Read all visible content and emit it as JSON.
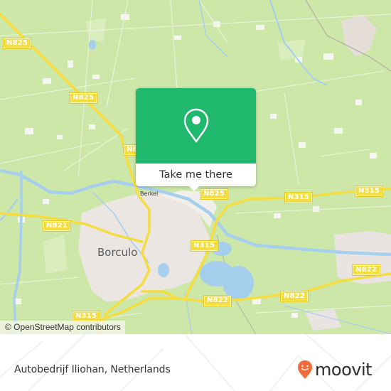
{
  "map": {
    "attribution": "© OpenStreetMap contributors",
    "places": [
      {
        "name": "Borculo",
        "type": "town"
      },
      {
        "name": "Berkel",
        "type": "river"
      }
    ],
    "road_labels": [
      {
        "id": "n825-a",
        "label": "N825"
      },
      {
        "id": "n825-b",
        "label": "N825"
      },
      {
        "id": "n825-c",
        "label": "N8"
      },
      {
        "id": "n825-d",
        "label": "N825"
      },
      {
        "id": "n315-a",
        "label": "N315"
      },
      {
        "id": "n315-b",
        "label": "N315"
      },
      {
        "id": "n315-c",
        "label": "N315"
      },
      {
        "id": "n315-d",
        "label": "N315"
      },
      {
        "id": "n821",
        "label": "N821"
      },
      {
        "id": "n822-a",
        "label": "N822"
      },
      {
        "id": "n822-b",
        "label": "N822"
      },
      {
        "id": "n822-c",
        "label": "N822"
      }
    ],
    "colors": {
      "land": "#cde7a9",
      "urban": "#ece6e3",
      "water": "#a6cfee",
      "road": "#f6dd3f"
    }
  },
  "popup": {
    "icon": "location-pin-icon",
    "button_label": "Take me there",
    "color": "#20b86c"
  },
  "footer": {
    "place_name": "Autobedrijf Iliohan, Netherlands",
    "brand": "moovit",
    "brand_color": "#f26b3a"
  }
}
